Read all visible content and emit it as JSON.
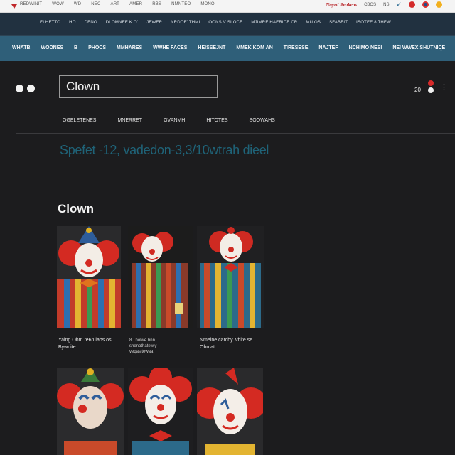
{
  "colors": {
    "accent": "#2f5f79",
    "navband": "#213140",
    "summary": "#1f6378",
    "brand_red": "#b8262a"
  },
  "topstrip": {
    "links": [
      "Redwinit",
      "Wow",
      "Wd",
      "Nec",
      "Art",
      "Amer",
      "Rbs",
      "Nmnteo",
      "Mono"
    ],
    "brand": "Nayrd Reakeos",
    "mini": [
      "Cbos",
      "Ns"
    ]
  },
  "navband": {
    "items": [
      "Ei Hetto",
      "Ho",
      "Deno",
      "Di Omnee K O'",
      "Jewer",
      "Nrdoe' Thmi",
      "Oons V Siioce",
      "Mjimre Haerice Cr",
      "Mu Os",
      "Sfabeit",
      "Isotee 8 Thew"
    ]
  },
  "catbar": {
    "items": [
      "Whatb",
      "Wodnes",
      "B",
      "Phocs",
      "Mmhares",
      "Wwhe Faces",
      "Heissejnt",
      "Mmek Kom An",
      "Tiresese",
      "Najtef",
      "Nchimo Nesi",
      "Nei Wwex Shutnice"
    ]
  },
  "search": {
    "value": "Clown"
  },
  "count": "20",
  "tabs": [
    "Ogeletenes",
    "Mnerret",
    "Gvanmh",
    "Hitotes",
    "Soowahs"
  ],
  "summary": "Spefet -12, vadedon-3,3/10wtrah dieel",
  "heading": "Clown",
  "results": [
    {
      "caption": "Yaing Ohm re6n lahs os Bywnite"
    },
    {
      "caption": "8 Tholwe bnn shenothatewly veqasitewaa"
    },
    {
      "caption": "Nmeine carchy 'vhite se Obmat"
    },
    {
      "caption": ""
    },
    {
      "caption": ""
    },
    {
      "caption": ""
    }
  ]
}
